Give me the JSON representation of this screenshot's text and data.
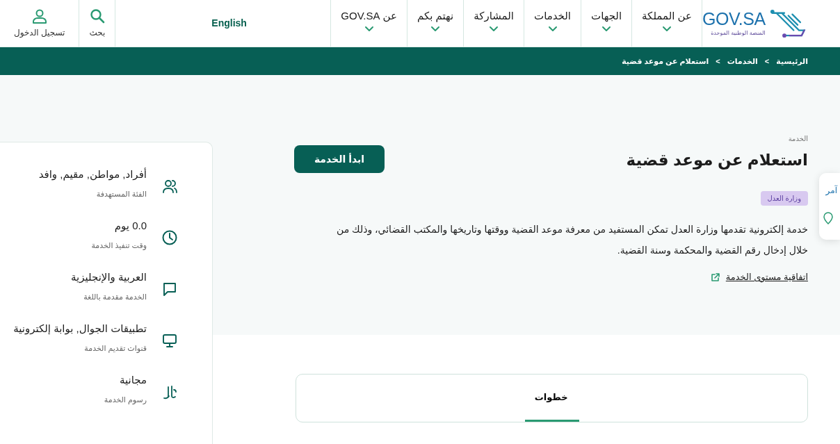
{
  "header": {
    "logo": {
      "title": "GOV.SA",
      "subtitle": "المنصة الوطنية الموحدة"
    },
    "nav": [
      {
        "label": "عن المملكة"
      },
      {
        "label": "الجهات"
      },
      {
        "label": "الخدمات"
      },
      {
        "label": "المشاركة"
      },
      {
        "label": "نهتم بكم"
      },
      {
        "label": "عن GOV.SA"
      }
    ],
    "language": "English",
    "search": "بحث",
    "login": "تسجيل الدخول"
  },
  "breadcrumb": {
    "items": [
      "الرئيسية",
      "الخدمات",
      "استعلام عن موعد قضية"
    ],
    "separator": ">"
  },
  "service": {
    "eyebrow": "الخدمة",
    "title": "استعلام عن موعد قضية",
    "start_button": "ابدأ الخدمة",
    "agency_tag": "وزارة العدل",
    "description": "خدمة إلكترونية تقدمها وزارة العدل تمكن المستفيد من معرفة موعد القضية ووقتها وتاريخها والمكتب القضائي، وذلك من خلال إدخال رقم القضية والمحكمة وسنة القضية.",
    "sla_link": "اتفاقية مستوى الخدمة"
  },
  "details": [
    {
      "kind": "people",
      "value": "أفراد, مواطن, مقيم, وافد",
      "label": "الفئة المستهدفة"
    },
    {
      "kind": "clock",
      "value": "0.0 يوم",
      "label": "وقت تنفيذ الخدمة"
    },
    {
      "kind": "chat",
      "value": "العربية والإنجليزية",
      "label": "الخدمة مقدمة باللغة"
    },
    {
      "kind": "monitor",
      "value": "تطبيقات الجوال, بوابة إلكترونية",
      "label": "قنوات تقديم الخدمة"
    },
    {
      "kind": "currency",
      "value": "مجانية",
      "label": "رسوم الخدمة"
    }
  ],
  "floating_card": {
    "text": "آمر"
  },
  "tabs": [
    {
      "label": "خطوات",
      "selected": true
    }
  ]
}
